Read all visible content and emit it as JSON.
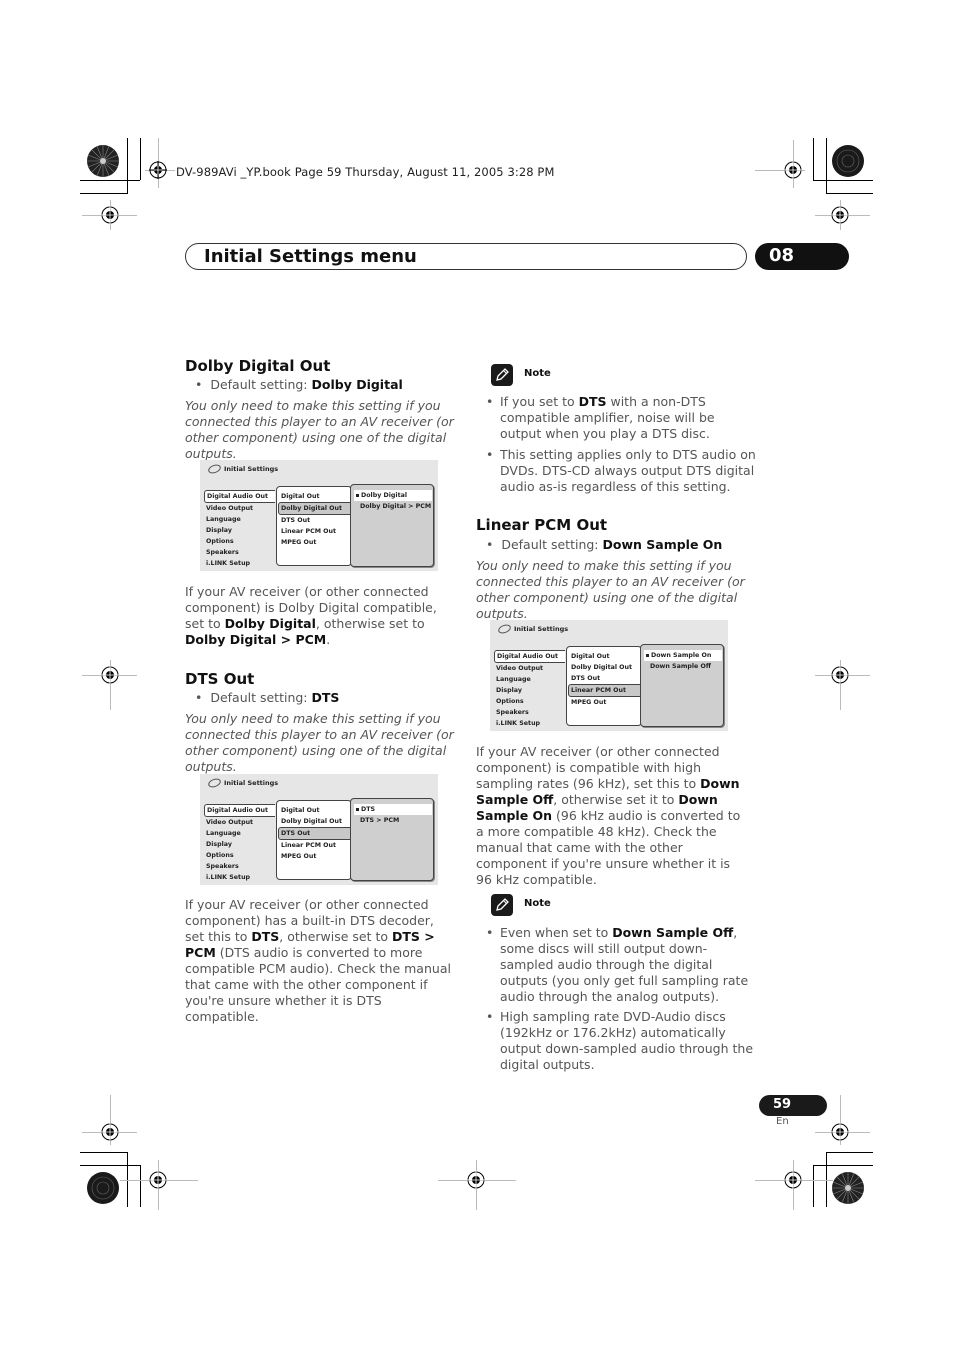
{
  "running_header": "DV-989AVi _YP.book  Page 59  Thursday, August 11, 2005  3:28 PM",
  "chapter": {
    "title": "Initial Settings menu",
    "number": "08"
  },
  "sections": {
    "dolby": {
      "heading": "Dolby Digital Out",
      "default_prefix": "Default setting: ",
      "default_value": "Dolby Digital",
      "intro": "You only need to make this setting if you connected this player to an AV receiver (or other component) using one of the digital outputs.",
      "body_1": "If your AV receiver (or other connected component) is Dolby Digital compatible, set to ",
      "body_b1": "Dolby Digital",
      "body_2": ", otherwise set to ",
      "body_b2": "Dolby Digital > PCM",
      "body_3": "."
    },
    "dts": {
      "heading": "DTS Out",
      "default_prefix": "Default setting: ",
      "default_value": "DTS",
      "intro": "You only need to make this setting if you connected this player to an AV receiver (or other component) using one of the digital outputs.",
      "body_1": "If your AV receiver (or other connected component) has a built-in DTS decoder, set this to ",
      "body_b1": "DTS",
      "body_2": ", otherwise set to ",
      "body_b2": "DTS > PCM",
      "body_3": " (DTS audio is converted to more compatible PCM audio). Check the manual that came with the other component if you're unsure whether it is DTS compatible."
    },
    "note1": {
      "label": "Note",
      "items": [
        {
          "pre": "If you set to ",
          "bold": "DTS",
          "post": " with a non-DTS compatible amplifier, noise will be output when you play a DTS disc."
        },
        {
          "pre": "This setting applies only to DTS audio on DVDs. DTS-CD always output DTS digital audio as-is regardless of this setting.",
          "bold": "",
          "post": ""
        }
      ]
    },
    "lpcm": {
      "heading": "Linear PCM Out",
      "default_prefix": "Default setting: ",
      "default_value": "Down Sample On",
      "intro": "You only need to make this setting if you connected this player to an AV receiver (or other component) using one of the digital outputs.",
      "body_1": "If your AV receiver (or other connected component) is compatible with high sampling rates (96 kHz), set this to ",
      "body_b1": "Down Sample Off",
      "body_2": ", otherwise set it to ",
      "body_b2": "Down Sample On",
      "body_3": " (96 kHz audio is converted to a more compatible 48 kHz). Check the manual that came with the other component if you're unsure whether it is 96 kHz compatible."
    },
    "note2": {
      "label": "Note",
      "items": [
        {
          "pre": "Even when set to ",
          "bold": "Down Sample Off",
          "post": ", some discs will still output down-sampled audio through the digital outputs (you only get full sampling rate audio through the analog outputs)."
        },
        {
          "pre": "High sampling rate DVD-Audio discs (192kHz or 176.2kHz) automatically output down-sampled audio through the digital outputs.",
          "bold": "",
          "post": ""
        }
      ]
    }
  },
  "osd_menu": {
    "title": "Initial Settings",
    "main_items": [
      "Digital Audio Out",
      "Video Output",
      "Language",
      "Display",
      "Options",
      "Speakers",
      "i.LINK Setup"
    ],
    "sub_items": [
      "Digital Out",
      "Dolby Digital Out",
      "DTS Out",
      "Linear PCM Out",
      "MPEG Out"
    ]
  },
  "screens": {
    "dolby": {
      "selected_sub": 1,
      "options": [
        "Dolby Digital",
        "Dolby Digital > PCM"
      ],
      "selected_option": 0
    },
    "dts": {
      "selected_sub": 2,
      "options": [
        "DTS",
        "DTS > PCM"
      ],
      "selected_option": 0
    },
    "lpcm": {
      "selected_sub": 3,
      "options": [
        "Down Sample On",
        "Down Sample Off"
      ],
      "selected_option": 0
    }
  },
  "footer": {
    "page_number": "59",
    "language": "En"
  }
}
